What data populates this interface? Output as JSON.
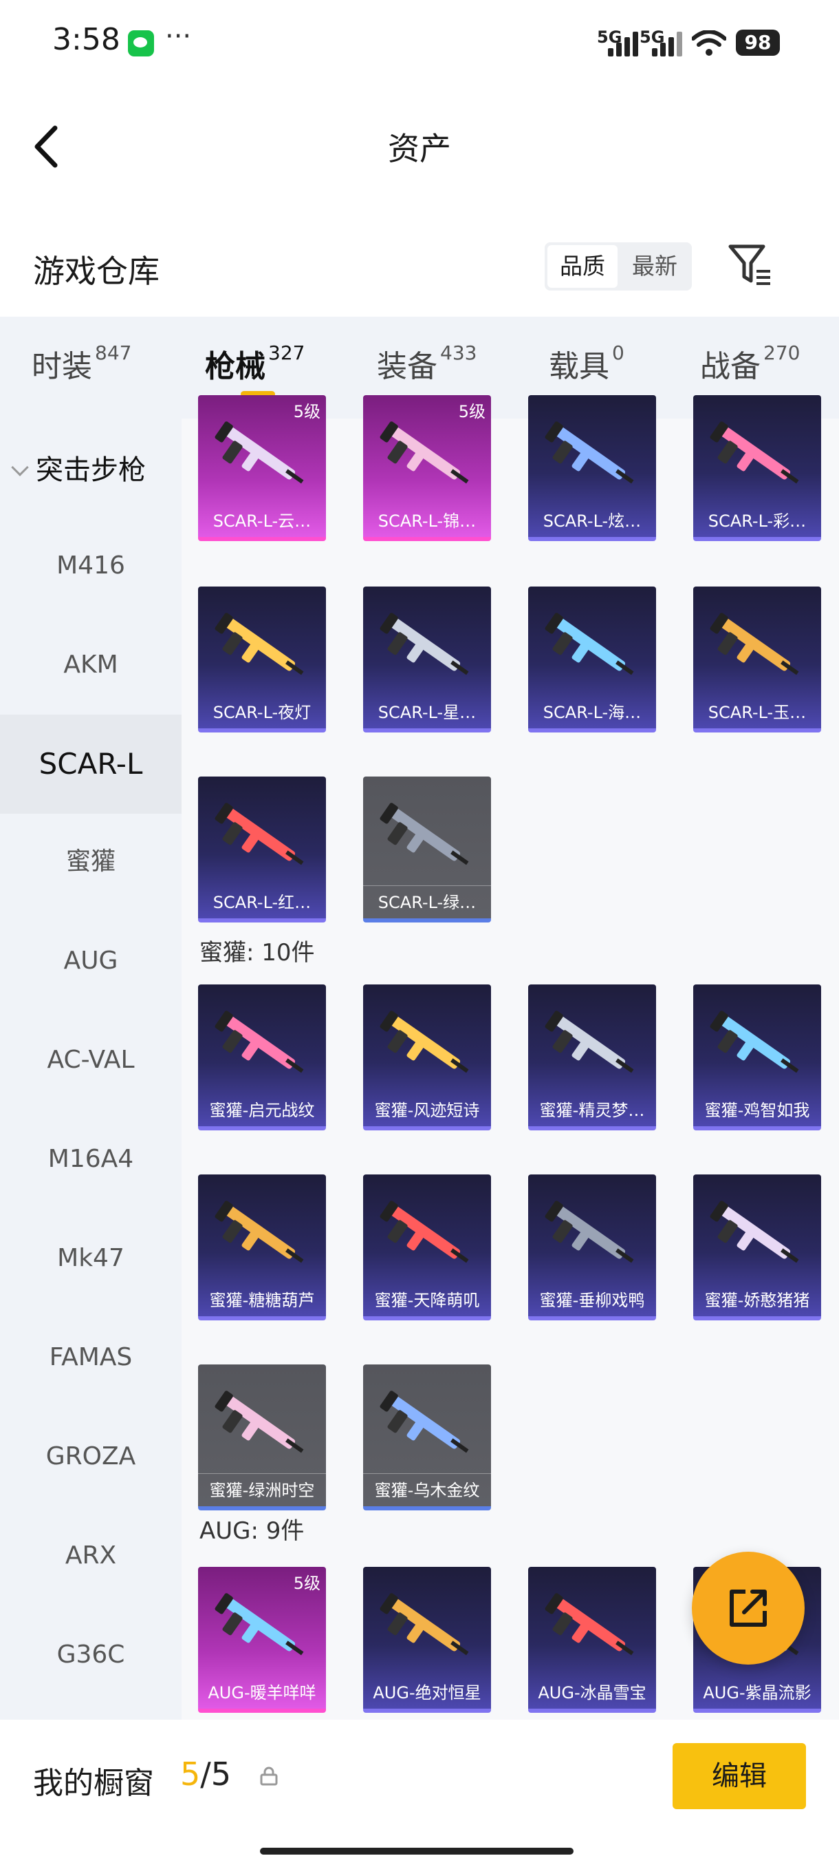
{
  "status": {
    "time": "3:58",
    "sig1": "5G",
    "sig2": "5G",
    "battery": "98"
  },
  "header": {
    "title": "资产"
  },
  "warehouse": {
    "title": "游戏仓库",
    "sort_quality": "品质",
    "sort_newest": "最新"
  },
  "tabs": [
    {
      "label": "时装",
      "count": "847"
    },
    {
      "label": "枪械",
      "count": "327"
    },
    {
      "label": "装备",
      "count": "433"
    },
    {
      "label": "载具",
      "count": "0"
    },
    {
      "label": "战备",
      "count": "270"
    }
  ],
  "sidebar": {
    "group": "突击步枪",
    "items": [
      "M416",
      "AKM",
      "SCAR-L",
      "蜜獾",
      "AUG",
      "AC-VAL",
      "M16A4",
      "Mk47",
      "FAMAS",
      "GROZA",
      "ARX",
      "G36C"
    ]
  },
  "sections": {
    "honey": "蜜獾: 10件",
    "aug": "AUG: 9件"
  },
  "cards": {
    "scar": [
      {
        "name": "SCAR-L-云…",
        "tier": "pink",
        "level": "5级"
      },
      {
        "name": "SCAR-L-锦…",
        "tier": "pink",
        "level": "5级"
      },
      {
        "name": "SCAR-L-炫…",
        "tier": "purple"
      },
      {
        "name": "SCAR-L-彩…",
        "tier": "purple"
      },
      {
        "name": "SCAR-L-夜灯",
        "tier": "purple"
      },
      {
        "name": "SCAR-L-星…",
        "tier": "purple"
      },
      {
        "name": "SCAR-L-海…",
        "tier": "purple"
      },
      {
        "name": "SCAR-L-玉…",
        "tier": "purple"
      },
      {
        "name": "SCAR-L-红…",
        "tier": "purple"
      },
      {
        "name": "SCAR-L-绿…",
        "tier": "grey"
      }
    ],
    "honey": [
      {
        "name": "蜜獾-启元战纹",
        "tier": "purple"
      },
      {
        "name": "蜜獾-风迹短诗",
        "tier": "purple"
      },
      {
        "name": "蜜獾-精灵梦…",
        "tier": "purple"
      },
      {
        "name": "蜜獾-鸡智如我",
        "tier": "purple"
      },
      {
        "name": "蜜獾-糖糖葫芦",
        "tier": "purple"
      },
      {
        "name": "蜜獾-天降萌叽",
        "tier": "purple"
      },
      {
        "name": "蜜獾-垂柳戏鸭",
        "tier": "purple"
      },
      {
        "name": "蜜獾-娇憨猪猪",
        "tier": "purple"
      },
      {
        "name": "蜜獾-绿洲时空",
        "tier": "grey"
      },
      {
        "name": "蜜獾-乌木金纹",
        "tier": "grey"
      }
    ],
    "aug": [
      {
        "name": "AUG-暖羊咩咩",
        "tier": "pink",
        "level": "5级"
      },
      {
        "name": "AUG-绝对恒星",
        "tier": "purple"
      },
      {
        "name": "AUG-冰晶雪宝",
        "tier": "purple"
      },
      {
        "name": "AUG-紫晶流影",
        "tier": "purple"
      }
    ]
  },
  "bottom": {
    "label": "我的橱窗",
    "count_current": "5",
    "count_sep_total": "/5",
    "edit": "编辑"
  }
}
